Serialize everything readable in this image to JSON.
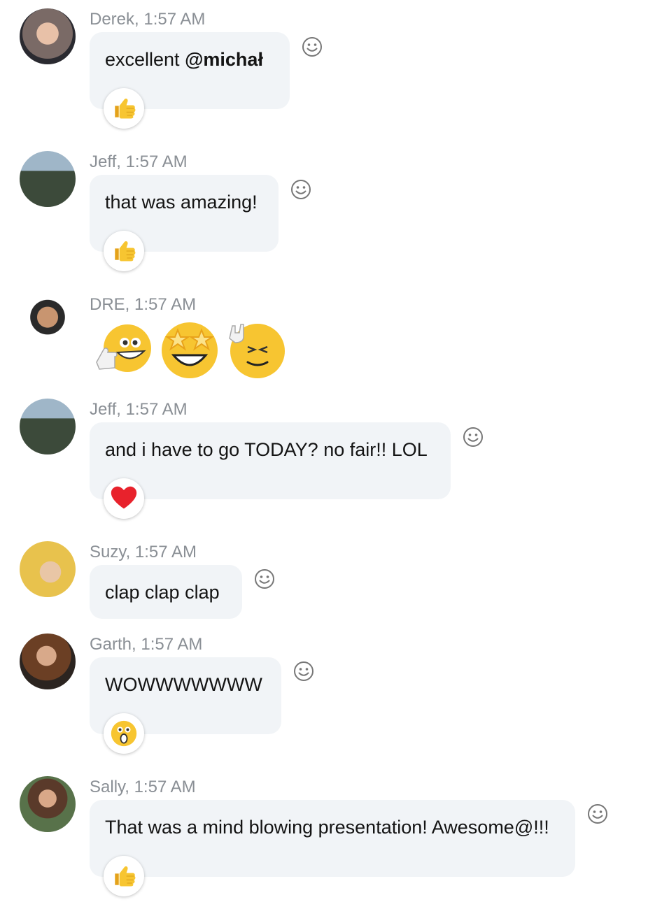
{
  "messages": [
    {
      "meta": "Derek, 1:57 AM",
      "text": "excellent ",
      "mention": "@michał",
      "reaction": "thumbs-up-icon"
    },
    {
      "meta": "Jeff, 1:57 AM",
      "text": "that was amazing!",
      "reaction": "thumbs-up-icon"
    },
    {
      "meta": "DRE, 1:57 AM",
      "emojis": [
        "thumb-grin-emoji",
        "star-struck-emoji",
        "rock-on-emoji"
      ]
    },
    {
      "meta": "Jeff, 1:57 AM",
      "text": "and i have to go TODAY? no fair!! LOL",
      "reaction": "heart-icon"
    },
    {
      "meta": "Suzy, 1:57 AM",
      "text": "clap clap clap"
    },
    {
      "meta": "Garth, 1:57 AM",
      "text": "WOWWWWWWW",
      "reaction": "surprised-face-icon"
    },
    {
      "meta": "Sally, 1:57 AM",
      "text": "That was a mind blowing presentation! Awesome@!!!",
      "reaction": "thumbs-up-icon"
    }
  ],
  "colors": {
    "bubble": "#f1f4f7",
    "meta": "#8a8f95",
    "emoji_yellow": "#f7c531",
    "heart": "#e8222c"
  }
}
